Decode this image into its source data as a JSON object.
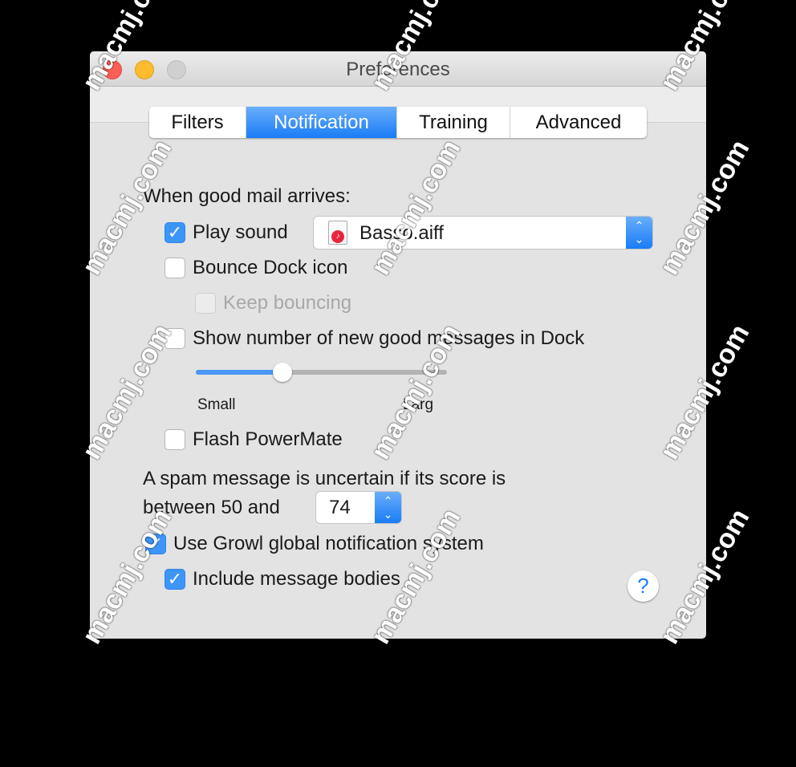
{
  "window": {
    "title": "Preferences"
  },
  "tabs": [
    {
      "label": "Filters",
      "selected": false
    },
    {
      "label": "Notification",
      "selected": true
    },
    {
      "label": "Training",
      "selected": false
    },
    {
      "label": "Advanced",
      "selected": false
    }
  ],
  "good_mail": {
    "heading": "When good mail arrives:",
    "play_sound": {
      "label": "Play sound",
      "checked": true
    },
    "sound_popup": {
      "value": "Basso.aiff",
      "icon": "audio-file-icon"
    },
    "bounce_dock": {
      "label": "Bounce Dock icon",
      "checked": false
    },
    "keep_bouncing": {
      "label": "Keep bouncing",
      "checked": false,
      "disabled": true
    },
    "show_number": {
      "label": "Show number of new good messages in Dock",
      "checked": false
    },
    "size_slider": {
      "min_label": "Small",
      "max_label": "Larg",
      "value_fraction": 0.345
    },
    "flash_powermate": {
      "label": "Flash PowerMate",
      "checked": false
    }
  },
  "spam": {
    "line1": "A spam message is uncertain if its score is",
    "line2": "between 50 and",
    "score_value": "74"
  },
  "growl": {
    "label": "Use Growl global notification system",
    "checked": true
  },
  "include_bodies": {
    "label": "Include message bodies",
    "checked": true
  },
  "help": {
    "label": "?"
  },
  "watermark": "macmj.com",
  "colors": {
    "accent": "#1a7cf6",
    "close": "#fc5f57",
    "minimize": "#fdbc2e",
    "zoom_disabled": "#d0d0d0"
  }
}
